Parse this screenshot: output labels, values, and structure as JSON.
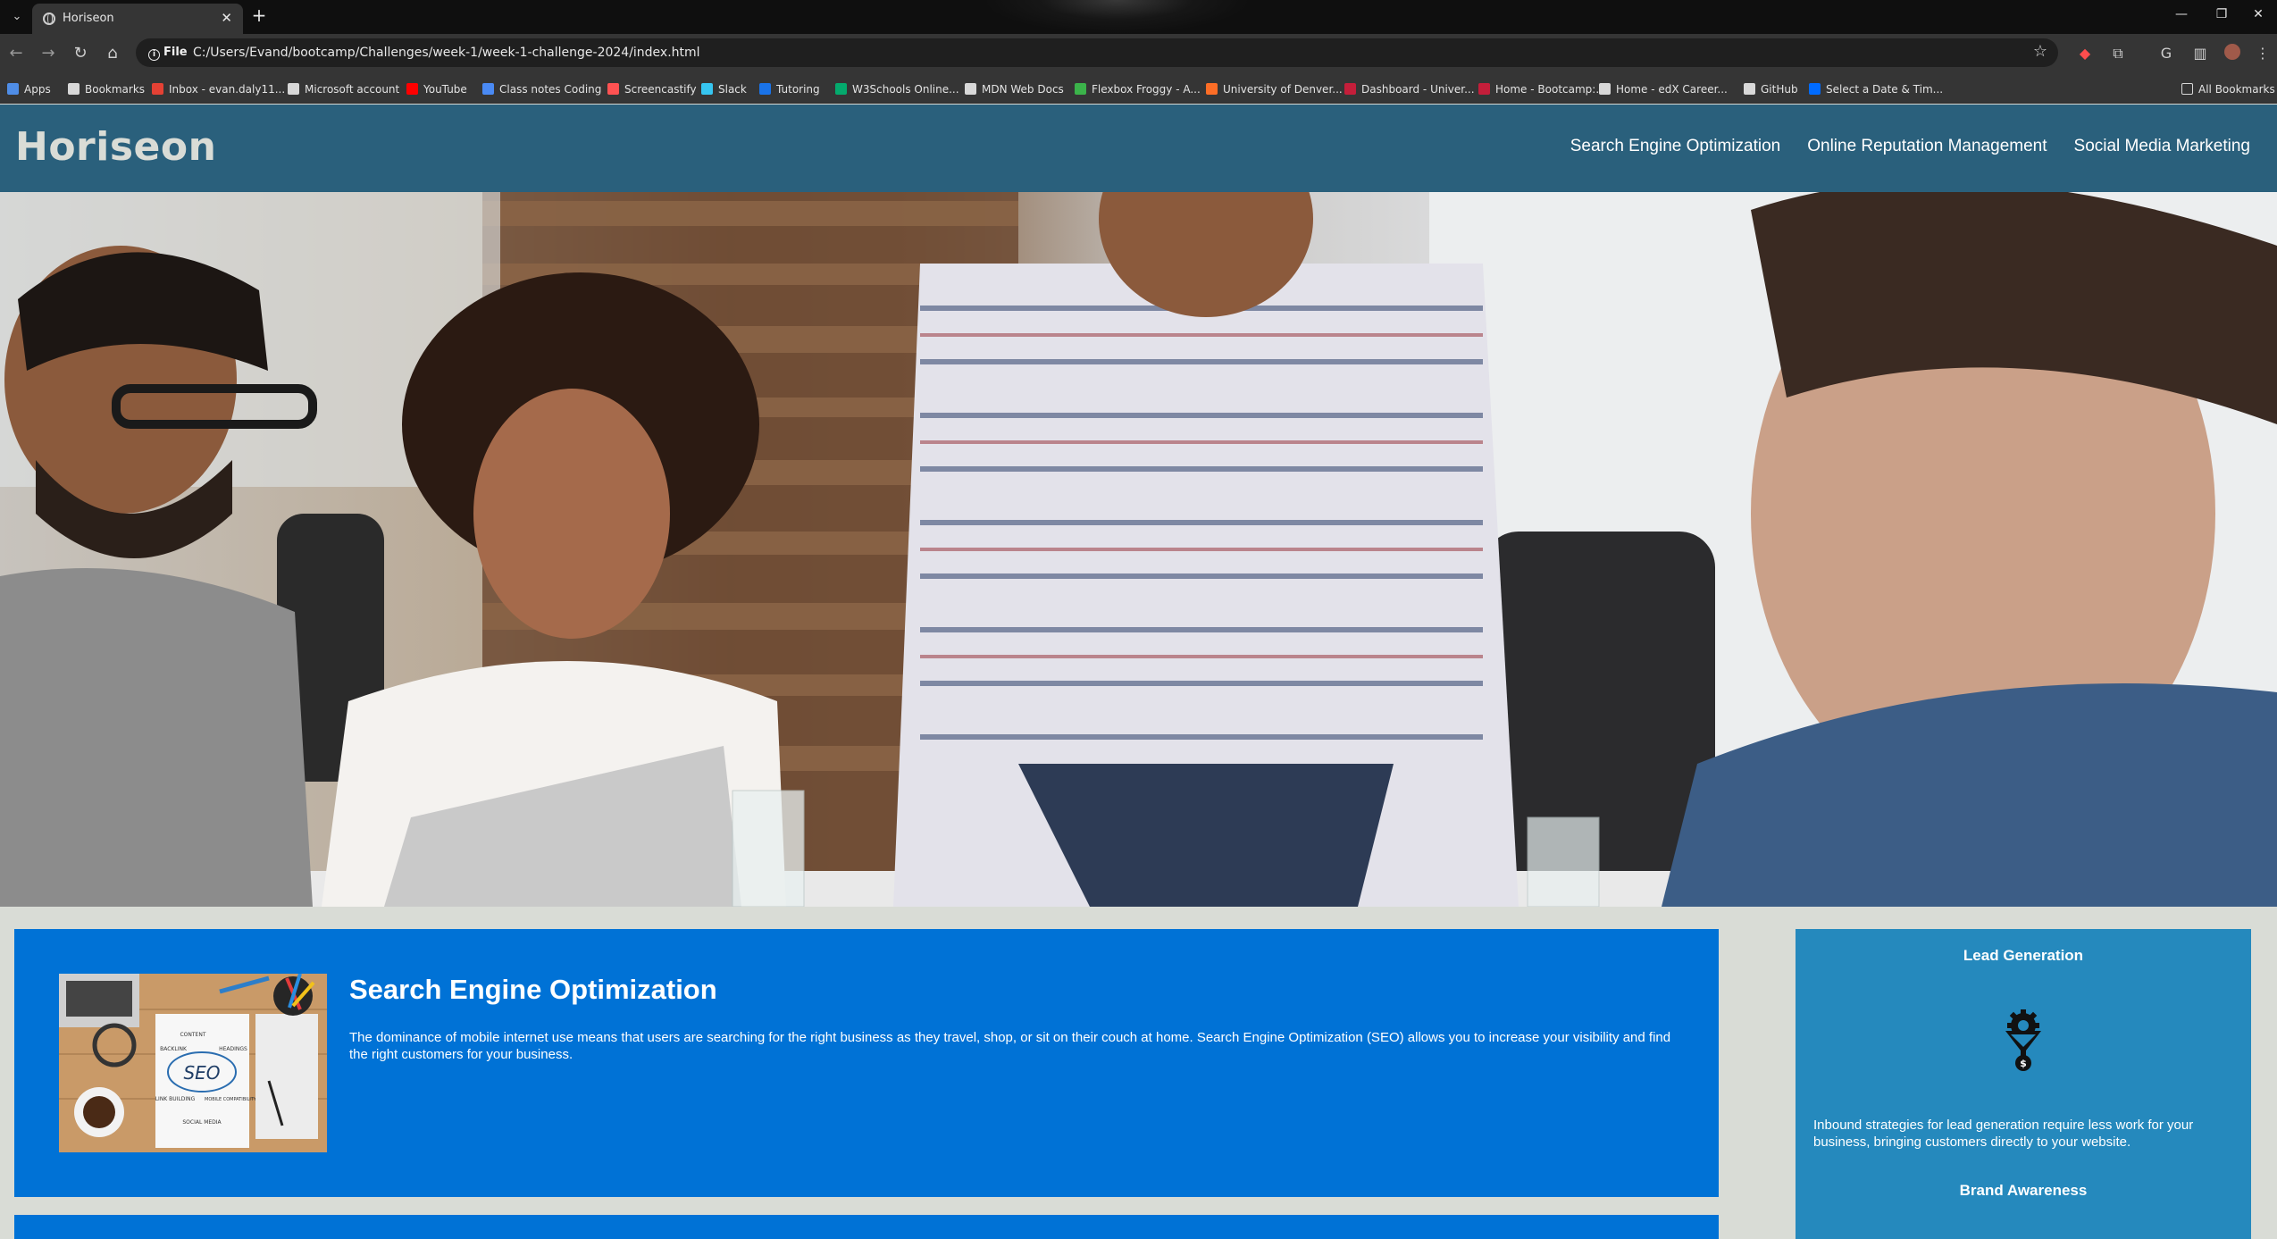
{
  "browser": {
    "tab_title": "Horiseon",
    "url_chip": "File",
    "url": "C:/Users/Evand/bootcamp/Challenges/week-1/week-1-challenge-2024/index.html",
    "bookmarks": [
      {
        "label": "Apps",
        "icon": "apps-grid-icon",
        "color": "#4f8de6"
      },
      {
        "label": "Bookmarks",
        "icon": "star-icon",
        "color": "#d8d8d8"
      },
      {
        "label": "Inbox - evan.daly11...",
        "icon": "gmail-icon",
        "color": "#e44134"
      },
      {
        "label": "Microsoft account",
        "icon": "microsoft-icon",
        "color": "#d8d8d8"
      },
      {
        "label": "YouTube",
        "icon": "youtube-icon",
        "color": "#ff0000"
      },
      {
        "label": "Class notes Coding",
        "icon": "docs-icon",
        "color": "#4a8af4"
      },
      {
        "label": "Screencastify",
        "icon": "screencastify-icon",
        "color": "#ff5252"
      },
      {
        "label": "Slack",
        "icon": "slack-icon",
        "color": "#36c5f0"
      },
      {
        "label": "Tutoring",
        "icon": "tutoring-icon",
        "color": "#1a73e8"
      },
      {
        "label": "W3Schools Online...",
        "icon": "w3schools-icon",
        "color": "#04aa6d"
      },
      {
        "label": "MDN Web Docs",
        "icon": "mdn-icon",
        "color": "#d8d8d8"
      },
      {
        "label": "Flexbox Froggy - A...",
        "icon": "frog-icon",
        "color": "#3bb34a"
      },
      {
        "label": "University of Denver...",
        "icon": "gitlab-icon",
        "color": "#fc6d26"
      },
      {
        "label": "Dashboard - Univer...",
        "icon": "canvas-icon",
        "color": "#c41e3a"
      },
      {
        "label": "Home - Bootcamp:...",
        "icon": "shield-icon",
        "color": "#c41e3a"
      },
      {
        "label": "Home - edX Career...",
        "icon": "edx-icon",
        "color": "#d8d8d8"
      },
      {
        "label": "GitHub",
        "icon": "github-icon",
        "color": "#d8d8d8"
      },
      {
        "label": "Select a Date & Tim...",
        "icon": "calendly-icon",
        "color": "#006bff"
      }
    ],
    "all_bookmarks": "All Bookmarks"
  },
  "site": {
    "logo": "Horiseon",
    "nav": [
      "Search Engine Optimization",
      "Online Reputation Management",
      "Social Media Marketing"
    ],
    "seo": {
      "title": "Search Engine Optimization",
      "body": "The dominance of mobile internet use means that users are searching for the right business as they travel, shop, or sit on their couch at home. Search Engine Optimization (SEO) allows you to increase your visibility and find the right customers for your business."
    },
    "benefits": {
      "lead_title": "Lead Generation",
      "lead_body": "Inbound strategies for lead generation require less work for your business, bringing customers directly to your website.",
      "brand_title": "Brand Awareness"
    },
    "seo_image": {
      "words": [
        "CONTENT",
        "BACKLINK",
        "HEADINGS",
        "SEO",
        "LINK BUILDING",
        "MOBILE COMPATIBILITY",
        "SOCIAL MEDIA"
      ]
    }
  }
}
